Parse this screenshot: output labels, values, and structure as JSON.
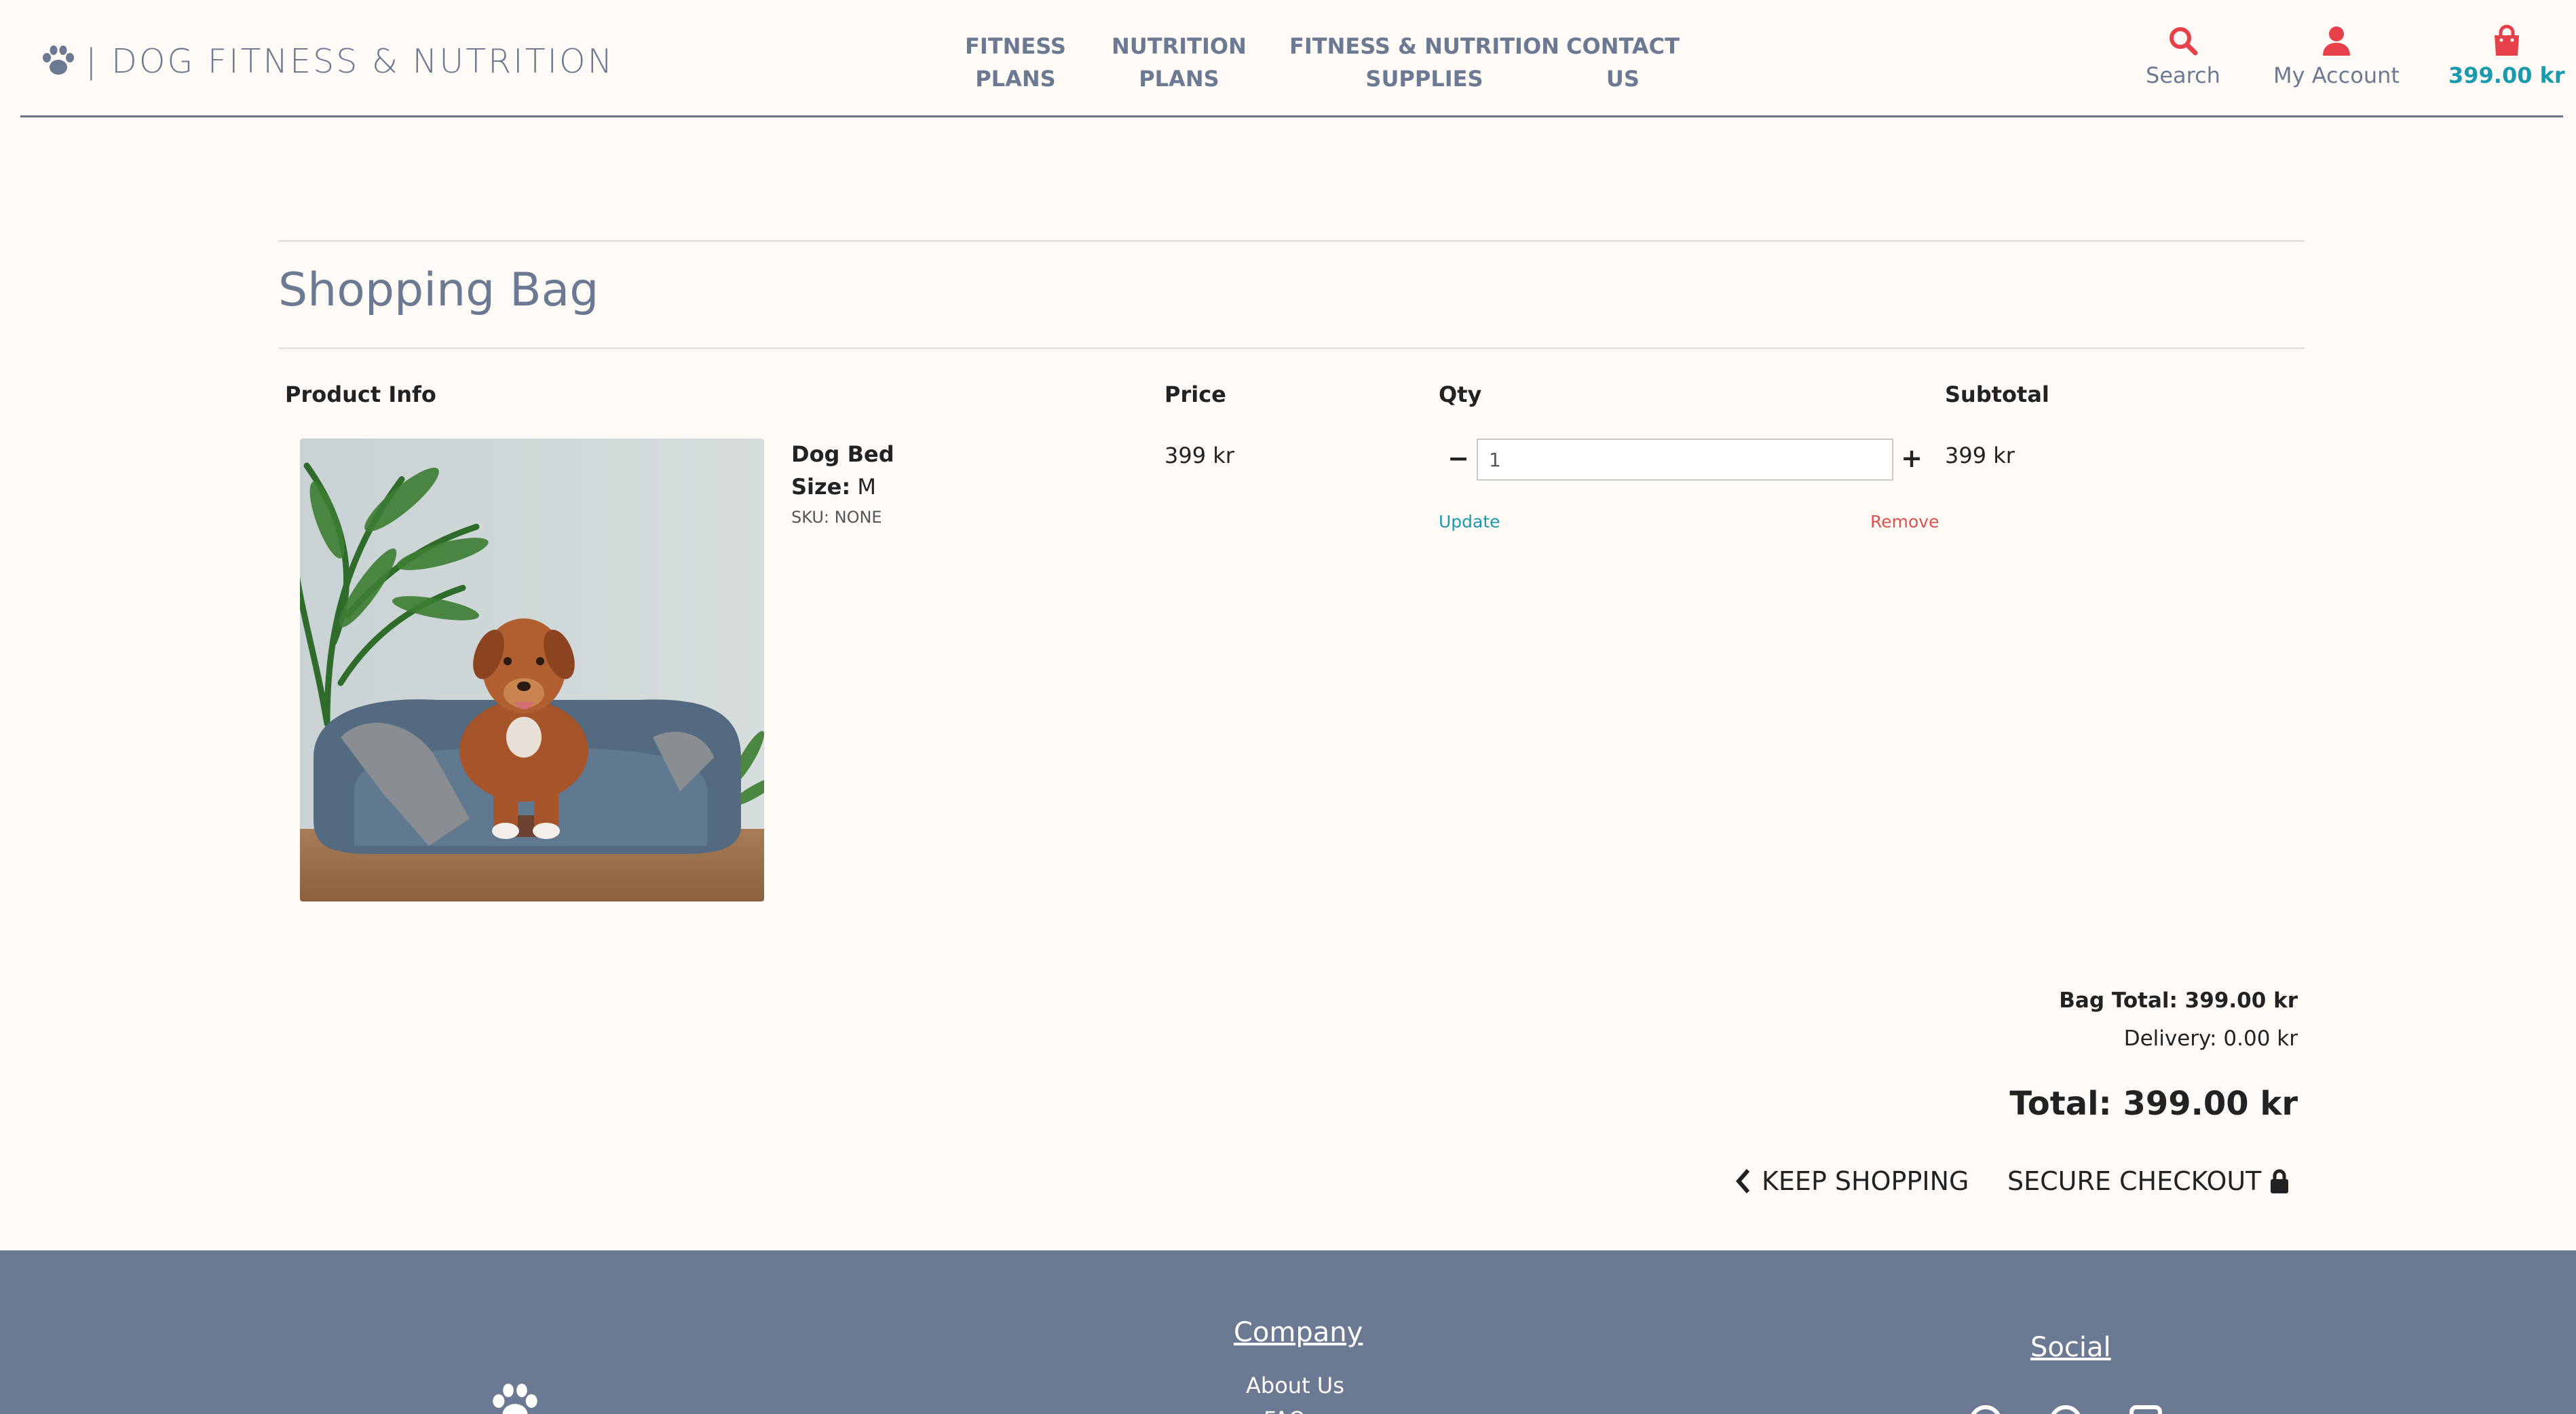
{
  "brand": {
    "name": "| DOG FITNESS & NUTRITION",
    "icon": "paw-icon"
  },
  "nav": {
    "items": [
      {
        "line1": "FITNESS",
        "line2": "PLANS"
      },
      {
        "line1": "NUTRITION",
        "line2": "PLANS"
      },
      {
        "line1": "FITNESS & NUTRITION",
        "line2": "SUPPLIES"
      },
      {
        "line1": "CONTACT",
        "line2": "US"
      }
    ]
  },
  "utilities": {
    "search": {
      "label": "Search",
      "icon": "search-icon",
      "color": "#e8404a"
    },
    "account": {
      "label": "My Account",
      "icon": "user-icon",
      "color": "#e8404a"
    },
    "bag": {
      "label": "399.00 kr",
      "icon": "shopping-bag-icon",
      "color": "#e8404a"
    }
  },
  "page": {
    "title": "Shopping Bag"
  },
  "table": {
    "headers": {
      "product": "Product Info",
      "price": "Price",
      "qty": "Qty",
      "subtotal": "Subtotal"
    }
  },
  "item": {
    "name": "Dog Bed",
    "size_label": "Size:",
    "size_value": "M",
    "sku": "SKU: NONE",
    "price": "399 kr",
    "qty": "1",
    "subtotal": "399 kr",
    "update_label": "Update",
    "remove_label": "Remove",
    "minus_label": "−",
    "plus_label": "+"
  },
  "totals": {
    "bag_total": "Bag Total: 399.00 kr",
    "delivery": "Delivery: 0.00 kr",
    "grand_total": "Total: 399.00 kr"
  },
  "actions": {
    "keep_shopping": "KEEP SHOPPING",
    "secure_checkout": "SECURE CHECKOUT"
  },
  "footer": {
    "company_heading": "Company",
    "about_us": "About Us",
    "faq": "FAQ",
    "social_heading": "Social"
  },
  "colors": {
    "accent_text": "#6b7a92",
    "bag_total_color": "#1a9aae",
    "icon_red": "#e8404a",
    "remove_red": "#d9534f",
    "footer_bg": "#6b7a92",
    "page_bg": "#fffaf6"
  }
}
